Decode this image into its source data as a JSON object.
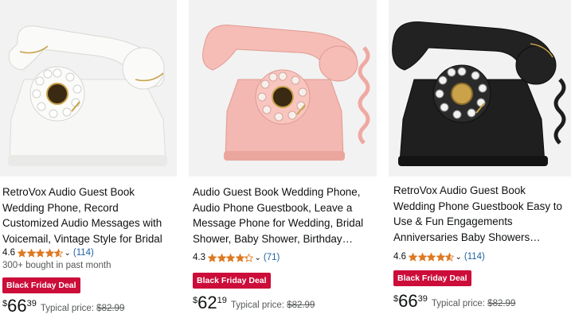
{
  "products": [
    {
      "title": "RetroVox Audio Guest Book Wedding Phone, Record Customized Audio Messages with Voicemail, Vintage Style for Bridal Shower,…",
      "rating": "4.6",
      "stars_value": 4.6,
      "reviews": "(114)",
      "bought": "300+ bought in past month",
      "deal": "Black Friday Deal",
      "currency": "$",
      "price_whole": "66",
      "price_fraction": "39",
      "typical_label": "Typical price:",
      "typical_price": "$82.99",
      "phone_color": "#f4f4f2",
      "image_bg": "#f2f2f2"
    },
    {
      "title": "Audio Guest Book Wedding Phone, Audio Phone Guestbook, Leave a Message Phone for Wedding, Bridal Shower, Baby Shower, Birthday…",
      "rating": "4.3",
      "stars_value": 4.3,
      "reviews": "(71)",
      "deal": "Black Friday Deal",
      "currency": "$",
      "price_whole": "62",
      "price_fraction": "19",
      "typical_label": "Typical price:",
      "typical_price": "$82.99",
      "phone_color": "#f2b3ad",
      "image_bg": "#f2f2f2"
    },
    {
      "title": "RetroVox Audio Guest Book Wedding Phone Guestbook Easy to Use & Fun Engagements Anniversaries Baby Showers…",
      "rating": "4.6",
      "stars_value": 4.6,
      "reviews": "(114)",
      "deal": "Black Friday Deal",
      "currency": "$",
      "price_whole": "66",
      "price_fraction": "39",
      "typical_label": "Typical price:",
      "typical_price": "$82.99",
      "phone_color": "#1b1b1b",
      "image_bg": "#f2f2f2"
    }
  ],
  "colors": {
    "star": "#de7921",
    "link": "#2162a1",
    "deal_badge": "#cc0c39"
  }
}
